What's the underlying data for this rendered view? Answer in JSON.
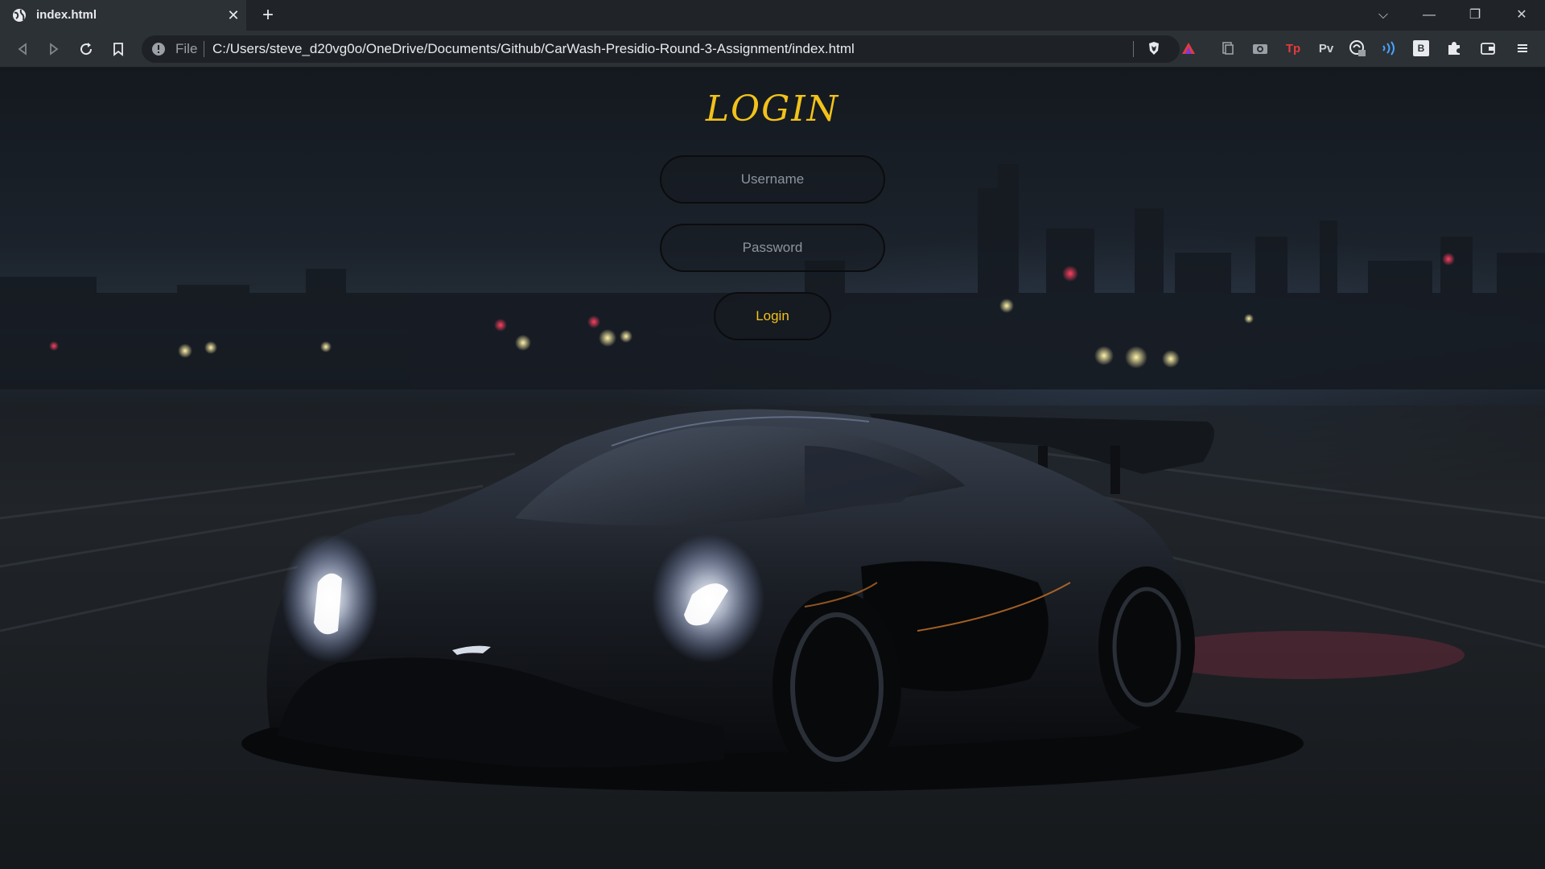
{
  "browser": {
    "tab": {
      "title": "index.html",
      "close_glyph": "✕"
    },
    "new_tab_glyph": "+",
    "window_controls": {
      "tab_search": "⌵",
      "minimize": "—",
      "restore": "❐",
      "close": "✕"
    },
    "address_bar": {
      "scheme_label": "File",
      "url": "C:/Users/steve_d20vg0o/OneDrive/Documents/Github/CarWash-Presidio-Round-3-Assignment/index.html"
    },
    "extensions": {
      "tp_label": "Tp",
      "pv_label": "Pv",
      "b_label": "B"
    }
  },
  "login": {
    "title": "LOGIN",
    "username_placeholder": "Username",
    "password_placeholder": "Password",
    "button_label": "Login"
  },
  "colors": {
    "accent": "#f2c21b",
    "chrome_bg": "#2c3136",
    "tabstrip_bg": "#202428"
  }
}
